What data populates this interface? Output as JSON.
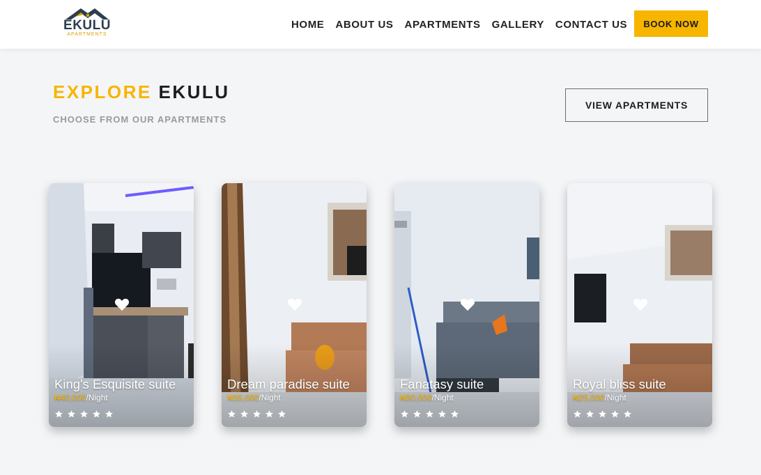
{
  "header": {
    "logo": {
      "word": "EKULU",
      "sub": "APARTMENTS"
    },
    "nav": [
      {
        "label": "HOME"
      },
      {
        "label": "ABOUT US"
      },
      {
        "label": "APARTMENTS"
      },
      {
        "label": "GALLERY"
      },
      {
        "label": "CONTACT US"
      }
    ],
    "book_label": "BOOK NOW"
  },
  "section": {
    "title_accent": "EXPLORE",
    "title_main": "EKULU",
    "subtitle": "CHOOSE FROM OUR APARTMENTS",
    "view_label": "VIEW APARTMENTS"
  },
  "cards": [
    {
      "name": "King's Esquisite suite",
      "price": "₦40,000",
      "per": "/Night",
      "rating": 5,
      "icon": "heart-icon"
    },
    {
      "name": "Dream paradise suite",
      "price": "₦35,000",
      "per": "/Night",
      "rating": 5,
      "icon": "heart-icon"
    },
    {
      "name": "Fanatasy suite",
      "price": "₦30,000",
      "per": "/Night",
      "rating": 5,
      "icon": "heart-icon"
    },
    {
      "name": "Royal bliss suite",
      "price": "₦25,000",
      "per": "/Night",
      "rating": 5,
      "icon": "heart-icon"
    }
  ],
  "colors": {
    "accent": "#f7b500",
    "page_bg": "#f4f5f7",
    "text_dark": "#1d1d1d",
    "text_muted": "#9a9a9a"
  }
}
